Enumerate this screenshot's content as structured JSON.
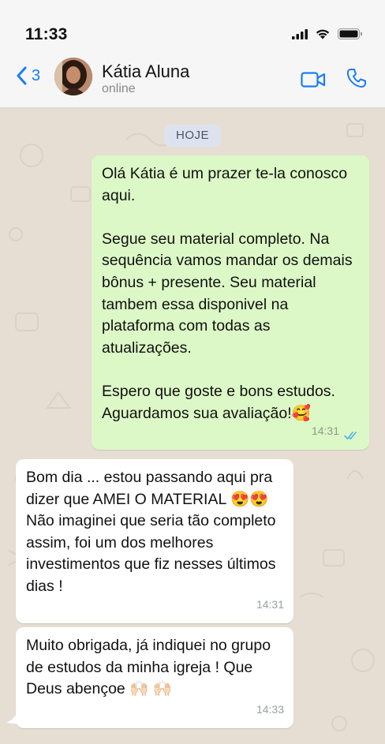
{
  "status_bar": {
    "time": "11:33"
  },
  "header": {
    "back_count": "3",
    "contact_name": "Kátia Aluna",
    "contact_status": "online"
  },
  "chat": {
    "date_label": "HOJE",
    "messages": [
      {
        "direction": "outgoing",
        "text": "Olá Kátia é um prazer te-la conosco aqui.\n\nSegue seu material completo. Na sequência vamos mandar os demais bônus + presente. Seu material tambem essa disponivel na plataforma com todas as atualizações.\n\nEspero que goste e bons estudos. Aguardamos sua avaliação!🥰",
        "time": "14:31",
        "status": "read"
      },
      {
        "direction": "incoming",
        "text": "Bom dia ... estou passando aqui pra dizer que AMEI O MATERIAL 😍😍\nNão imaginei que seria tão completo assim, foi um dos melhores investimentos que fiz nesses últimos dias !",
        "time": "14:31"
      },
      {
        "direction": "incoming",
        "text": "Muito obrigada, já indiquei no grupo de estudos da minha igreja ! Que Deus abençoe 🙌🏻 🙌🏻",
        "time": "14:33"
      }
    ]
  },
  "colors": {
    "accent": "#1a7cf5",
    "outgoing_bubble": "#dcf8c6",
    "incoming_bubble": "#ffffff",
    "chat_background": "#e6ded3",
    "read_ticks": "#4fb3e8"
  },
  "icons": [
    "signal-icon",
    "wifi-icon",
    "battery-icon",
    "back-chevron-icon",
    "video-call-icon",
    "phone-call-icon",
    "read-ticks-icon"
  ]
}
